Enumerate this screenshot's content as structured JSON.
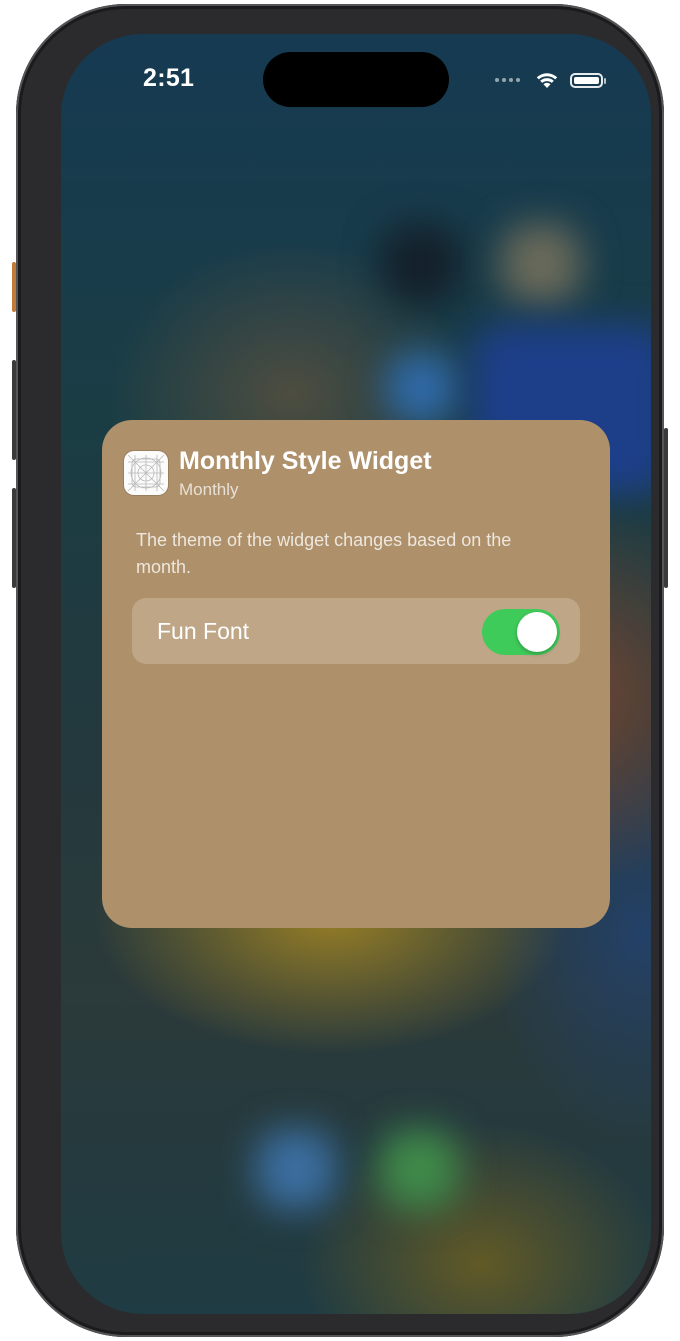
{
  "status_bar": {
    "time": "2:51",
    "signal_icon": "signal-dots-icon",
    "wifi_icon": "wifi-icon",
    "battery_icon": "battery-icon"
  },
  "widget_config": {
    "app_icon": "app-grid-icon",
    "title": "Monthly Style Widget",
    "subtitle": "Monthly",
    "description": "The theme of the widget changes based on the month.",
    "settings": [
      {
        "label": "Fun Font",
        "value": true,
        "on_color": "#3fcb5a"
      }
    ]
  },
  "colors": {
    "card_background": "#ae906a",
    "phone_frame": "#2b2b2d"
  }
}
